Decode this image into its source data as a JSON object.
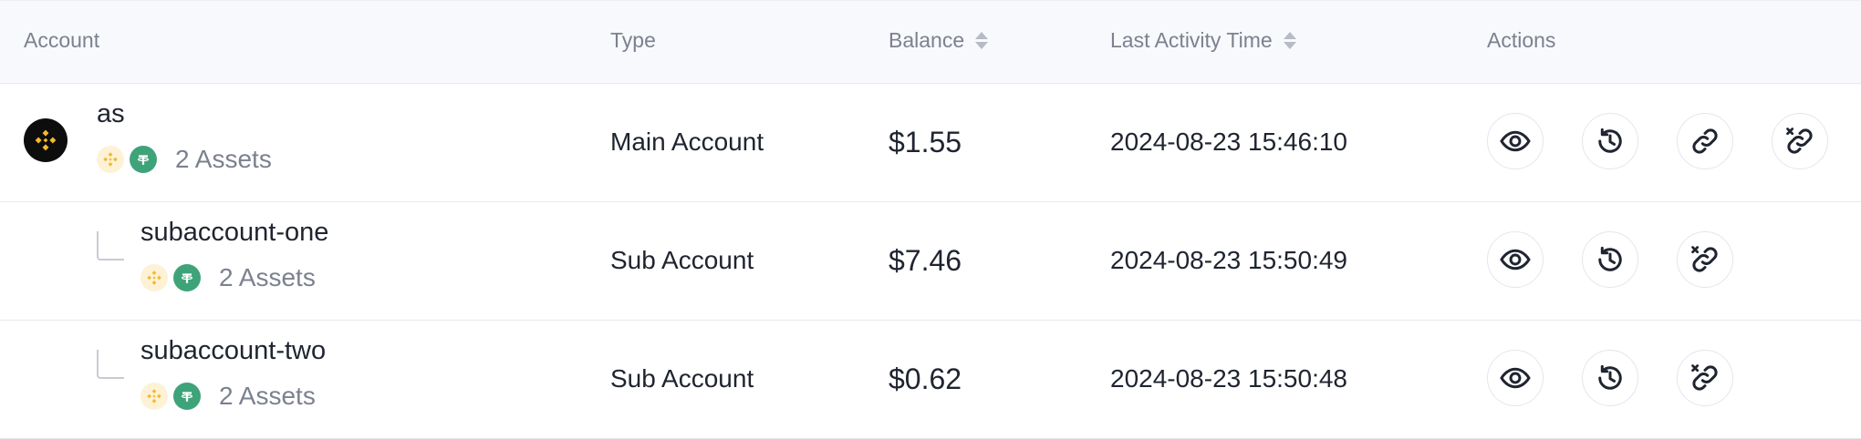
{
  "header": {
    "account": "Account",
    "type": "Type",
    "balance": "Balance",
    "last_activity": "Last Activity Time",
    "actions": "Actions"
  },
  "rows": [
    {
      "name": "as",
      "type": "Main Account",
      "balance": "$1.55",
      "last_activity": "2024-08-23 15:46:10",
      "assets": "2 Assets",
      "coins": [
        "bnb-coin-icon",
        "usdt-coin-icon"
      ],
      "actions": [
        "view-icon",
        "history-icon",
        "link-icon",
        "unlink-icon"
      ]
    },
    {
      "name": "subaccount-one",
      "type": "Sub Account",
      "balance": "$7.46",
      "last_activity": "2024-08-23 15:50:49",
      "assets": "2 Assets",
      "coins": [
        "bnb-coin-icon",
        "usdt-coin-icon"
      ],
      "actions": [
        "view-icon",
        "history-icon",
        "unlink-icon"
      ]
    },
    {
      "name": "subaccount-two",
      "type": "Sub Account",
      "balance": "$0.62",
      "last_activity": "2024-08-23 15:50:48",
      "assets": "2 Assets",
      "coins": [
        "bnb-coin-icon",
        "usdt-coin-icon"
      ],
      "actions": [
        "view-icon",
        "history-icon",
        "unlink-icon"
      ]
    }
  ],
  "colors": {
    "header_bg": "#f8f9fc",
    "border": "#e6e8ee",
    "muted_text": "#7c8190",
    "bnb": "#f3ba2f",
    "usdt": "#3fa37a"
  }
}
